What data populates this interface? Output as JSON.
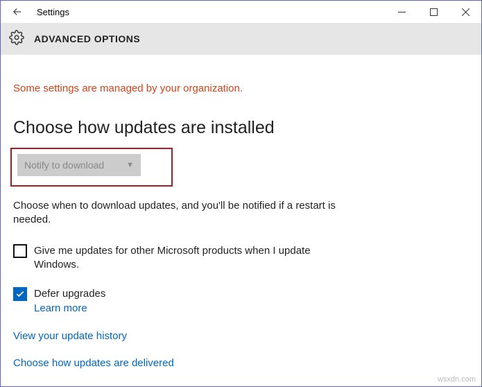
{
  "titlebar": {
    "title": "Settings"
  },
  "header": {
    "title": "ADVANCED OPTIONS"
  },
  "notice": "Some settings are managed by your organization.",
  "section": {
    "heading": "Choose how updates are installed",
    "dropdown_value": "Notify to download",
    "description": "Choose when to download updates, and you'll be notified if a restart is needed."
  },
  "options": {
    "other_products": {
      "checked": false,
      "label": "Give me updates for other Microsoft products when I update Windows."
    },
    "defer": {
      "checked": true,
      "label": "Defer upgrades",
      "learn_more": "Learn more"
    }
  },
  "links": {
    "history": "View your update history",
    "delivery": "Choose how updates are delivered"
  },
  "watermark": "wsxdn.com"
}
